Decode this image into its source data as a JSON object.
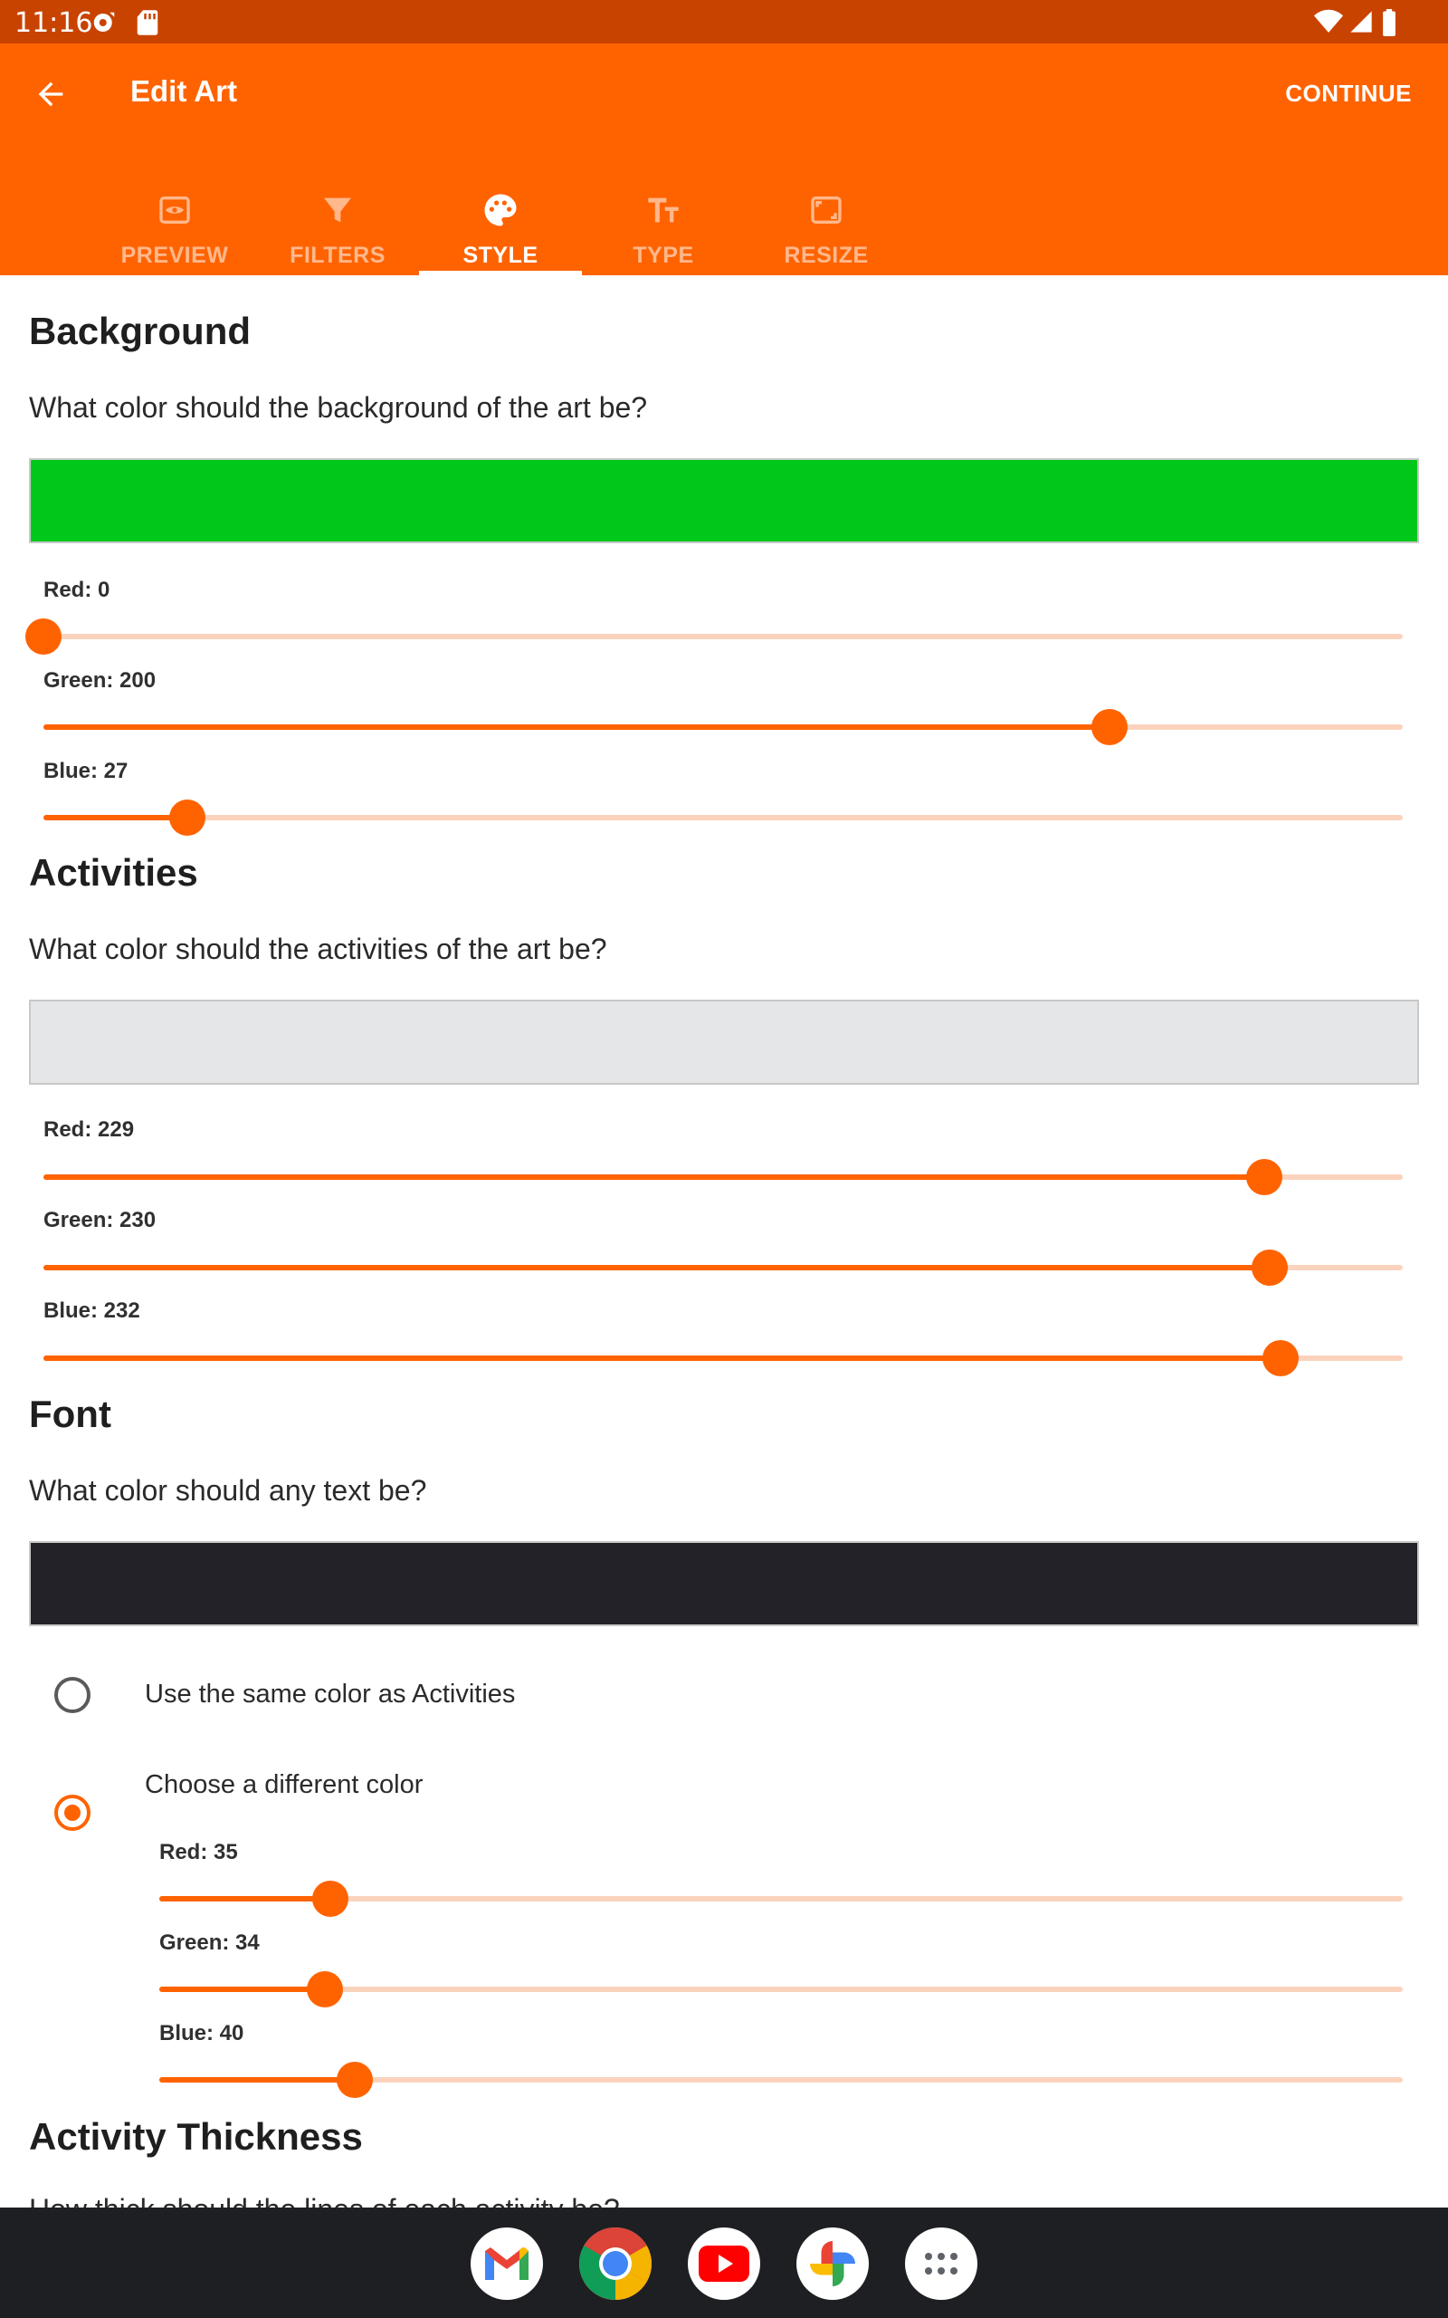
{
  "status_bar": {
    "time": "11:16"
  },
  "app_bar": {
    "title": "Edit Art",
    "continue_label": "CONTINUE",
    "tabs": [
      {
        "label": "PREVIEW",
        "icon": "preview-icon"
      },
      {
        "label": "FILTERS",
        "icon": "filter-icon"
      },
      {
        "label": "STYLE",
        "icon": "palette-icon",
        "active": true
      },
      {
        "label": "TYPE",
        "icon": "text-size-icon"
      },
      {
        "label": "RESIZE",
        "icon": "resize-icon"
      }
    ]
  },
  "colors": {
    "accent": "#ff6300",
    "status_bar": "#c94300",
    "track": "#fbd3bd"
  },
  "background": {
    "heading": "Background",
    "question": "What color should the background of the art be?",
    "swatch": "#00c81b",
    "red_label": "Red: 0",
    "red": 0,
    "green_label": "Green: 200",
    "green": 200,
    "blue_label": "Blue: 27",
    "blue": 27
  },
  "activities": {
    "heading": "Activities",
    "question": "What color should the activities of the art be?",
    "swatch": "#e5e6e8",
    "red_label": "Red: 229",
    "red": 229,
    "green_label": "Green: 230",
    "green": 230,
    "blue_label": "Blue: 232",
    "blue": 232
  },
  "font": {
    "heading": "Font",
    "question": "What color should any text be?",
    "swatch": "#232228",
    "option_same": "Use the same color as Activities",
    "option_different": "Choose a different color",
    "selected": "different",
    "red_label": "Red: 35",
    "red": 35,
    "green_label": "Green: 34",
    "green": 34,
    "blue_label": "Blue: 40",
    "blue": 40
  },
  "thickness": {
    "heading": "Activity Thickness",
    "question": "How thick should the lines of each activity be?"
  },
  "dock": [
    "gmail-icon",
    "chrome-icon",
    "youtube-icon",
    "photos-icon",
    "app-drawer-icon"
  ]
}
